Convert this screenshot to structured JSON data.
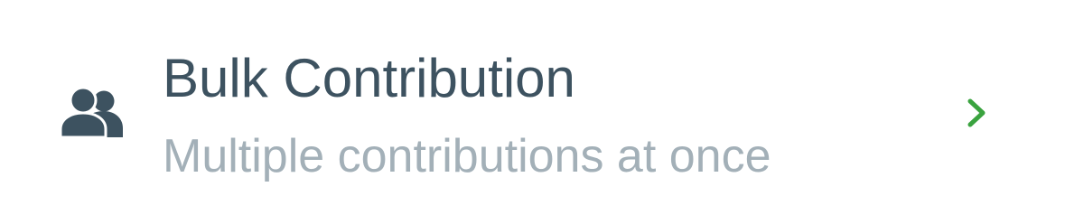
{
  "row": {
    "icon": "users-icon",
    "title": "Bulk Contribution",
    "subtitle": "Multiple contributions at once",
    "chevron_icon": "chevron-right-icon"
  },
  "colors": {
    "icon": "#3d5260",
    "title": "#3d5260",
    "subtitle": "#a3b0b8",
    "chevron": "#3aa33f",
    "background": "#ffffff"
  }
}
